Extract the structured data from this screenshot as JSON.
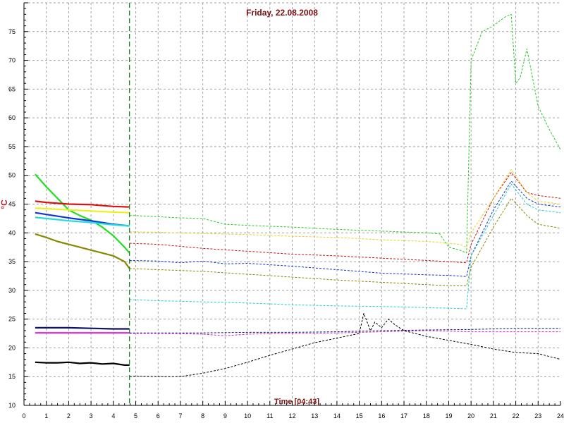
{
  "chart_data": {
    "type": "line",
    "title": "Friday, 22.08.2008",
    "xlabel": "Time [04:43]",
    "ylabel": "°C",
    "xlim": [
      0,
      24
    ],
    "ylim": [
      10,
      80
    ],
    "x_ticks": [
      "0",
      "1",
      "2",
      "3",
      "4",
      "5",
      "6",
      "7",
      "8",
      "9",
      "10",
      "11",
      "12",
      "13",
      "14",
      "15",
      "16",
      "17",
      "18",
      "19",
      "20",
      "21",
      "22",
      "23",
      "24"
    ],
    "y_ticks": [
      "10",
      "15",
      "20",
      "25",
      "30",
      "35",
      "40",
      "45",
      "50",
      "55",
      "60",
      "65",
      "70",
      "75"
    ],
    "grid": true,
    "current_time_marker": 4.72,
    "colors": {
      "title": "#7a1010",
      "xlabel": "#7a1010",
      "ylabel": "#b02020",
      "grid": "#a0a0a0",
      "marker": "#1a8a1a"
    },
    "series": [
      {
        "color": "#22dd22",
        "style": "solid",
        "x": [
          0.5,
          1,
          1.5,
          2,
          2.5,
          3,
          3.5,
          4,
          4.5,
          4.72
        ],
        "y": [
          50.2,
          48,
          46,
          44,
          43,
          42.2,
          41,
          39.5,
          37.5,
          36.5
        ]
      },
      {
        "color": "#22cc22",
        "style": "dashed",
        "x": [
          4.72,
          5,
          6,
          7,
          8,
          8.5,
          9,
          10,
          12,
          14,
          16,
          18,
          18.6,
          19,
          19.5,
          19.8,
          20,
          20.5,
          21,
          21.5,
          21.8,
          22,
          22.2,
          22.5,
          23,
          23.5,
          24
        ],
        "y": [
          43,
          43,
          42.8,
          42.6,
          42.5,
          42,
          41.5,
          41.3,
          41,
          40.6,
          40.3,
          40,
          39.8,
          37.5,
          37,
          36.5,
          70,
          75,
          76,
          77.5,
          78,
          66,
          67,
          72,
          62,
          58,
          54.5
        ]
      },
      {
        "color": "#dd1111",
        "style": "solid",
        "x": [
          0.5,
          1,
          2,
          3,
          4,
          4.72
        ],
        "y": [
          45.5,
          45.3,
          45,
          44.9,
          44.6,
          44.5
        ]
      },
      {
        "color": "#cc1111",
        "style": "dashed",
        "x": [
          4.72,
          6,
          8,
          10,
          12,
          14,
          16,
          18,
          19,
          19.8,
          20,
          21,
          21.8,
          22.5,
          23,
          24
        ],
        "y": [
          38.2,
          38,
          37.3,
          36.8,
          36.3,
          36,
          35.6,
          35.2,
          35,
          34.8,
          38,
          46,
          50.5,
          47,
          46.5,
          46
        ]
      },
      {
        "color": "#eeee22",
        "style": "solid",
        "x": [
          0.5,
          1,
          2,
          3,
          4,
          4.72
        ],
        "y": [
          44.3,
          44.2,
          44,
          43.8,
          43.6,
          43.5
        ]
      },
      {
        "color": "#e8d020",
        "style": "dashed",
        "x": [
          4.72,
          6,
          8,
          10,
          12,
          14,
          16,
          18,
          19,
          19.5,
          19.8,
          20,
          21,
          21.8,
          22.5,
          23,
          24
        ],
        "y": [
          40.2,
          40.1,
          39.9,
          39.7,
          39.4,
          39.2,
          38.8,
          38.5,
          38.2,
          38,
          37.5,
          40,
          46,
          51,
          47,
          45.5,
          45
        ]
      },
      {
        "color": "#1133dd",
        "style": "solid",
        "x": [
          0.5,
          1,
          2,
          3,
          4,
          4.72
        ],
        "y": [
          43.5,
          43.2,
          42.6,
          42.1,
          41.5,
          41.2
        ]
      },
      {
        "color": "#1133cc",
        "style": "dashed",
        "x": [
          4.72,
          6,
          7,
          8,
          9,
          10,
          12,
          14,
          16,
          18,
          19,
          19.8,
          20,
          21,
          21.8,
          22.5,
          23,
          24
        ],
        "y": [
          35.2,
          35.1,
          34.8,
          35.1,
          34.6,
          34.7,
          34.2,
          33.6,
          33,
          32.7,
          32.6,
          32.4,
          36,
          44,
          49,
          46,
          45,
          44.5
        ]
      },
      {
        "color": "#22dddd",
        "style": "solid",
        "x": [
          0.5,
          1,
          2,
          3,
          4,
          4.72
        ],
        "y": [
          42.7,
          42.5,
          42.1,
          41.8,
          41.4,
          41.2
        ]
      },
      {
        "color": "#22cccc",
        "style": "dashed",
        "x": [
          4.72,
          6,
          8,
          10,
          12,
          14,
          16,
          18,
          19,
          19.8,
          20,
          21,
          21.8,
          22.5,
          23,
          24
        ],
        "y": [
          28.4,
          28.2,
          28,
          27.8,
          27.5,
          27.3,
          27.2,
          27,
          26.9,
          26.8,
          36,
          43,
          48.5,
          45,
          44,
          43.5
        ]
      },
      {
        "color": "#888800",
        "style": "solid",
        "x": [
          0.5,
          1,
          1.5,
          2,
          2.5,
          3,
          3.5,
          4,
          4.5,
          4.72
        ],
        "y": [
          39.8,
          39.2,
          38.5,
          38,
          37.5,
          37,
          36.5,
          36,
          35,
          33.8
        ]
      },
      {
        "color": "#888800",
        "style": "dashed",
        "x": [
          4.72,
          6,
          8,
          10,
          12,
          14,
          16,
          18,
          19,
          19.8,
          20,
          21,
          21.8,
          22.5,
          23,
          24
        ],
        "y": [
          33.8,
          33.6,
          33.3,
          32.8,
          32.3,
          31.8,
          31.4,
          31,
          30.8,
          30.8,
          34,
          41,
          46,
          43,
          41.5,
          40.8
        ]
      },
      {
        "color": "#111166",
        "style": "solid",
        "x": [
          0.5,
          1,
          2,
          3,
          4,
          4.72
        ],
        "y": [
          23.5,
          23.5,
          23.5,
          23.4,
          23.3,
          23.3
        ]
      },
      {
        "color": "#111166",
        "style": "dashed",
        "x": [
          4.72,
          6,
          8,
          10,
          12,
          14,
          16,
          18,
          20,
          22,
          23,
          24
        ],
        "y": [
          22.6,
          22.6,
          22.6,
          22.7,
          22.7,
          22.8,
          23,
          23.1,
          23.2,
          23.4,
          23.4,
          23.4
        ]
      },
      {
        "color": "#dd22dd",
        "style": "solid",
        "x": [
          0.5,
          1,
          2,
          3,
          4,
          4.72
        ],
        "y": [
          22.6,
          22.6,
          22.6,
          22.6,
          22.6,
          22.6
        ]
      },
      {
        "color": "#cc22cc",
        "style": "dashed",
        "x": [
          4.72,
          6,
          8,
          9,
          10,
          12,
          14,
          16,
          18,
          20,
          22,
          24
        ],
        "y": [
          22.5,
          22.5,
          22.4,
          22.1,
          22.4,
          22.5,
          22.6,
          22.8,
          23,
          22.8,
          22.8,
          22.8
        ]
      },
      {
        "color": "#000000",
        "style": "solid",
        "x": [
          0.5,
          1,
          1.5,
          2,
          2.5,
          3,
          3.5,
          4,
          4.5,
          4.72
        ],
        "y": [
          17.5,
          17.4,
          17.4,
          17.5,
          17.3,
          17.4,
          17.2,
          17.3,
          17,
          17
        ]
      },
      {
        "color": "#000000",
        "style": "dashed",
        "x": [
          4.72,
          5,
          6,
          7,
          8,
          9,
          10,
          11,
          12,
          13,
          14,
          15,
          15.2,
          15.5,
          15.7,
          16,
          16.3,
          16.6,
          17,
          18,
          19,
          20,
          21,
          22,
          23,
          24
        ],
        "y": [
          15,
          15.1,
          15,
          15,
          15.6,
          16.4,
          17.5,
          18.7,
          19.8,
          20.9,
          21.7,
          22.5,
          26,
          23,
          24.5,
          23.5,
          25,
          24,
          23,
          22,
          21.3,
          20.6,
          19.8,
          19.2,
          19,
          18
        ]
      }
    ]
  }
}
